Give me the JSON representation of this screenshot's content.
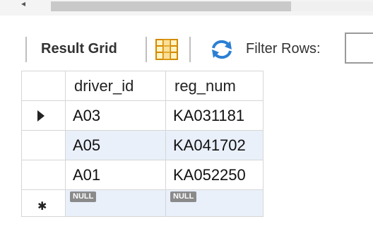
{
  "toolbar": {
    "result_grid_label": "Result Grid",
    "filter_label": "Filter Rows:",
    "filter_value": ""
  },
  "icons": {
    "grid": "grid-layout-icon",
    "refresh": "refresh-icon",
    "scroll_left": "scroll-left-arrow-icon"
  },
  "colors": {
    "alt_row": "#e9f0fa",
    "null_badge": "#8a8a8a"
  },
  "table": {
    "columns": [
      "driver_id",
      "reg_num"
    ],
    "rows": [
      {
        "driver_id": "A03",
        "reg_num": "KA031181"
      },
      {
        "driver_id": "A05",
        "reg_num": "KA041702"
      },
      {
        "driver_id": "A01",
        "reg_num": "KA052250"
      }
    ],
    "new_row": {
      "driver_id": "NULL",
      "reg_num": "NULL"
    }
  }
}
